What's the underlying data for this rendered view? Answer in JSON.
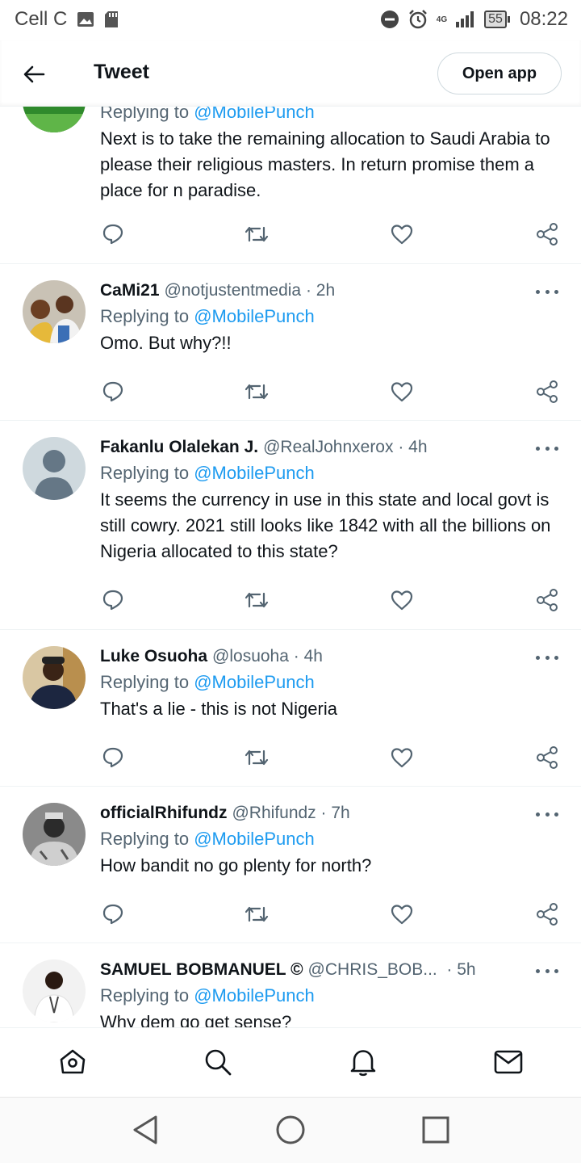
{
  "status_bar": {
    "carrier": "Cell C",
    "network": "4G",
    "battery": "55",
    "time": "08:22"
  },
  "header": {
    "title": "Tweet",
    "open_app_label": "Open app"
  },
  "tweets": [
    {
      "reply_prefix": "Replying to",
      "reply_mention": "@MobilePunch",
      "text": "Next is to take the remaining allocation to Saudi Arabia to please their religious masters. In return promise them a place for n paradise."
    },
    {
      "name": "CaMi21",
      "handle": "@notjustentmedia",
      "time": "· 2h",
      "reply_prefix": "Replying to",
      "reply_mention": "@MobilePunch",
      "text": "Omo. But why?!!"
    },
    {
      "name": "Fakanlu Olalekan J.",
      "handle": "@RealJohnxerox",
      "time": "· 4h",
      "reply_prefix": "Replying to",
      "reply_mention": "@MobilePunch",
      "text": "It seems the currency in use in this state and local govt is still cowry. 2021 still looks like 1842 with all the billions on Nigeria allocated to this state?"
    },
    {
      "name": "Luke Osuoha",
      "handle": "@losuoha",
      "time": "· 4h",
      "reply_prefix": "Replying to",
      "reply_mention": "@MobilePunch",
      "text": "That's a lie - this is not Nigeria"
    },
    {
      "name": "officialRhifundz",
      "handle": "@Rhifundz",
      "time": "· 7h",
      "reply_prefix": "Replying to",
      "reply_mention": "@MobilePunch",
      "text": "How bandit no go plenty for north?"
    },
    {
      "name": "SAMUEL BOBMANUEL ©",
      "handle": "@CHRIS_BOB...",
      "time": "· 5h",
      "reply_prefix": "Replying to",
      "reply_mention": "@MobilePunch",
      "text": "Why dem go get sense?"
    }
  ],
  "icons": {
    "reply": "reply-icon",
    "retweet": "retweet-icon",
    "like": "like-icon",
    "share": "share-icon",
    "home": "home-icon",
    "search": "search-icon",
    "notifications": "bell-icon",
    "messages": "mail-icon"
  },
  "colors": {
    "mention": "#1d9bf0",
    "secondary_text": "#536471",
    "primary_text": "#0f1419"
  }
}
